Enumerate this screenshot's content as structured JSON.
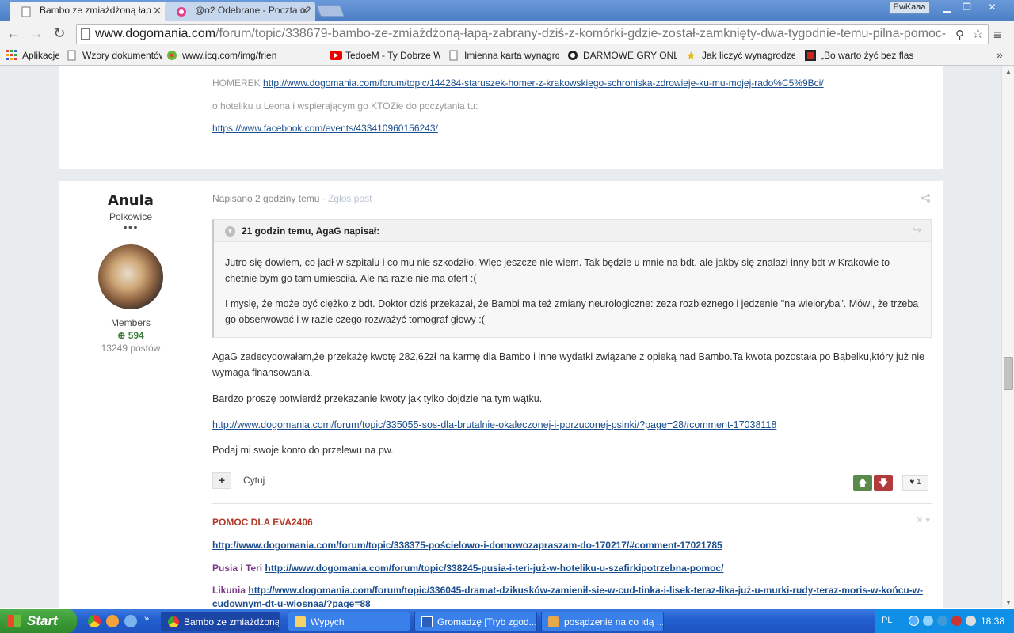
{
  "browser": {
    "tabs": [
      {
        "title": "Bambo ze zmiażdżoną łap"
      },
      {
        "title": "@o2 Odebrane - Poczta o2"
      }
    ],
    "window_user": "EwKaaa",
    "url_host": "www.dogomania.com",
    "url_path": "/forum/topic/338679-bambo-ze-zmiażdżoną-łapą-zabrany-dziś-z-komórki-gdzie-został-zamknięty-dwa-tygodnie-temu-pilna-pomoc-"
  },
  "bookmarks": [
    {
      "label": "Aplikacje",
      "icon": "apps-grid-icon"
    },
    {
      "label": "Wzory dokumentów",
      "icon": "page-icon"
    },
    {
      "label": "www.icq.com/img/friend",
      "icon": "icq-flower-icon"
    },
    {
      "label": "",
      "icon": "page-icon"
    },
    {
      "label": "",
      "icon": "facebook-icon"
    },
    {
      "label": "TedoeM - Ty Dobrze W",
      "icon": "youtube-icon"
    },
    {
      "label": "Imienna karta wynagrod",
      "icon": "page-icon"
    },
    {
      "label": "DARMOWE GRY ONLINE",
      "icon": "games-icon"
    },
    {
      "label": "Jak liczyć wynagrodzenie",
      "icon": "star-icon"
    },
    {
      "label": "„Bo warto żyć bez flaszk",
      "icon": "news-icon"
    }
  ],
  "prev_post": {
    "homer_label": "HOMEREK",
    "homer_link": "http://www.dogomania.com/forum/topic/144284-staruszek-homer-z-krakowskiego-schroniska-zdrowieje-ku-mu-mojej-rado%C5%9Bci/",
    "hotel_text": "o hoteliku u Leona i wspierającym go KTOZie do poczytania tu:",
    "fb_link": "https://www.facebook.com/events/433410960156243/"
  },
  "author": {
    "name": "Anula",
    "location": "Polkowice",
    "rank_dots": "●●●",
    "group": "Members",
    "reputation": "594",
    "posts": "13249 postów"
  },
  "post": {
    "posted": "Napisano 2 godziny temu",
    "report": " · Zgłoś post",
    "quote_title": "21 godzin temu, AgaG napisał:",
    "quote_p1": "Jutro się dowiem, co jadł w szpitalu i co mu nie szkodziło. Więc jeszcze nie wiem. Tak będzie u mnie na bdt, ale jakby się znalazł inny bdt w Krakowie to chetnie bym go tam umiesciła. Ale na razie nie ma ofert :(",
    "quote_p2": "I myslę, że może być ciężko z bdt. Doktor dziś przekazał, że Bambi ma też zmiany neurologiczne: zeza rozbieznego i jedzenie \"na wieloryba\". Mówi, że trzeba go obserwować i w razie czego rozważyć tomograf głowy :(",
    "p1": "AgaG zadecydowałam,że przekażę kwotę 282,62zł na karmę dla Bambo i inne wydatki związane z opieką nad Bambo.Ta kwota pozostała po Bąbelku,który już nie wymaga finansowania.",
    "p2": "Bardzo proszę potwierdź przekazanie kwoty jak tylko dojdzie na tym wątku.",
    "link": "http://www.dogomania.com/forum/topic/335055-sos-dla-brutalnie-okaleczonej-i-porzuconej-psinki/?page=28#comment-17038118",
    "p3": "Podaj mi swoje konto do przelewu na pw.",
    "quote_button": "Cytuj",
    "likes": "1"
  },
  "signature": {
    "heading": "POMOC DLA EVA2406",
    "link1": "http://www.dogomania.com/forum/topic/338375-pościelowo-i-domowozapraszam-do-170217/#comment-17021785",
    "pusia_label": "Pusia i Teri",
    "pusia_link": "http://www.dogomania.com/forum/topic/338245-pusia-i-teri-już-w-hoteliku-u-szafirkipotrzebna-pomoc/",
    "likunia_label": "Likunia",
    "likunia_link": "http://www.dogomania.com/forum/topic/336045-dramat-dzikusków-zamienił-sie-w-cud-tinka-i-lisek-teraz-lika-już-u-murki-rudy-teraz-moris-w-końcu-w-cudownym-dt-u-wiosnaa/?page=88"
  },
  "taskbar": {
    "start": "Start",
    "tasks": [
      "Bambo ze zmiażdżoną...",
      "Wypych",
      "Gromadzę [Tryb zgod...",
      "posądzenie na co idą ..."
    ],
    "lang": "PL",
    "clock": "18:38"
  },
  "colors": {
    "link": "#1b4e8e",
    "signature_heading": "#b23a2a",
    "signature_label": "#7b3a8a",
    "vote_up": "#5a8a4a",
    "vote_down": "#b13a3a"
  }
}
